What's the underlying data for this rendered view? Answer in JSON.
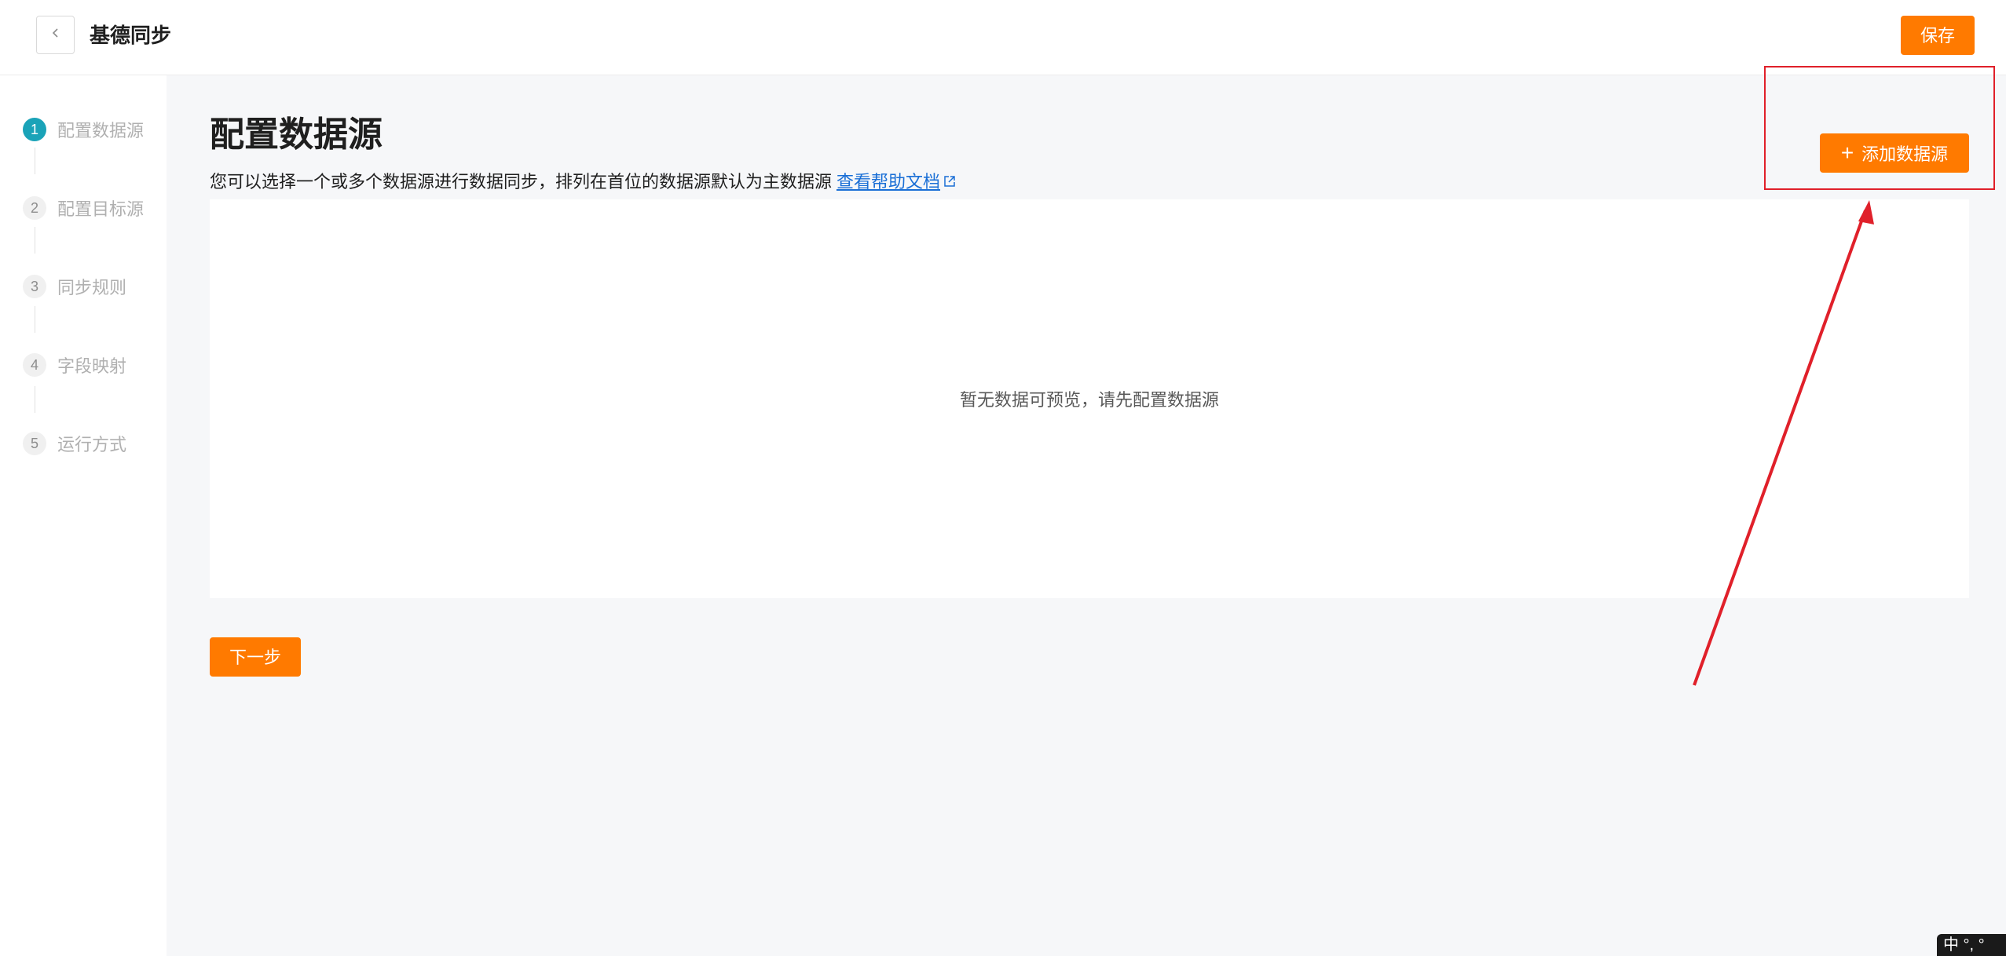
{
  "header": {
    "title": "基德同步",
    "save_label": "保存"
  },
  "steps": [
    {
      "num": "1",
      "label": "配置数据源",
      "active": true
    },
    {
      "num": "2",
      "label": "配置目标源",
      "active": false
    },
    {
      "num": "3",
      "label": "同步规则",
      "active": false
    },
    {
      "num": "4",
      "label": "字段映射",
      "active": false
    },
    {
      "num": "5",
      "label": "运行方式",
      "active": false
    }
  ],
  "main": {
    "title": "配置数据源",
    "description": "您可以选择一个或多个数据源进行数据同步，排列在首位的数据源默认为主数据源",
    "help_link": "查看帮助文档",
    "add_button": "添加数据源",
    "empty_text": "暂无数据可预览，请先配置数据源",
    "next_button": "下一步"
  },
  "ime": {
    "label": "中 °, °"
  },
  "colors": {
    "accent": "#ff7a00",
    "active_step": "#1aa3b8",
    "link": "#1a6fd6",
    "annotation": "#e0202a"
  }
}
